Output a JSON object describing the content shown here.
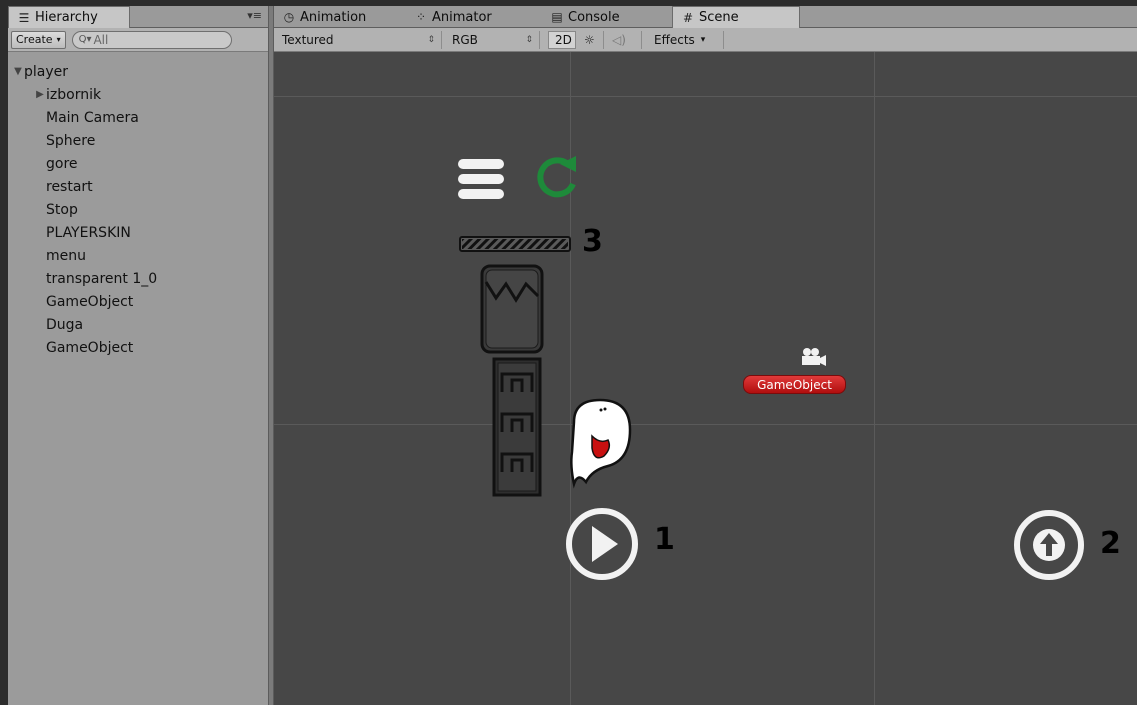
{
  "hierarchy": {
    "tab_label": "Hierarchy",
    "create_label": "Create",
    "search_placeholder": "All",
    "items": [
      {
        "label": "player",
        "expanded": true,
        "indent": 0
      },
      {
        "label": "izbornik",
        "expanded": false,
        "indent": 1
      },
      {
        "label": "Main Camera",
        "indent": 1
      },
      {
        "label": "Sphere",
        "indent": 1
      },
      {
        "label": "gore",
        "indent": 1
      },
      {
        "label": "restart",
        "indent": 1
      },
      {
        "label": "Stop",
        "indent": 1
      },
      {
        "label": "PLAYERSKIN",
        "indent": 1
      },
      {
        "label": "menu",
        "indent": 1
      },
      {
        "label": "transparent 1_0",
        "indent": 1
      },
      {
        "label": "GameObject",
        "indent": 1
      },
      {
        "label": "Duga",
        "indent": 1
      },
      {
        "label": "GameObject",
        "indent": 1
      }
    ]
  },
  "tabs": [
    {
      "label": "Animation",
      "icon": "clock-icon"
    },
    {
      "label": "Animator",
      "icon": "animator-icon"
    },
    {
      "label": "Console",
      "icon": "console-icon"
    },
    {
      "label": "Scene",
      "icon": "grid-icon",
      "active": true
    }
  ],
  "scene_toolbar": {
    "draw_mode": "Textured",
    "color_mode": "RGB",
    "mode_2d": "2D",
    "effects": "Effects"
  },
  "scene": {
    "labels": [
      "3",
      "1",
      "2"
    ],
    "gameobject_label": "GameObject",
    "colors": {
      "viewport": "#474747",
      "restart": "#1e8a3a",
      "badge": "#c41a1a"
    }
  }
}
